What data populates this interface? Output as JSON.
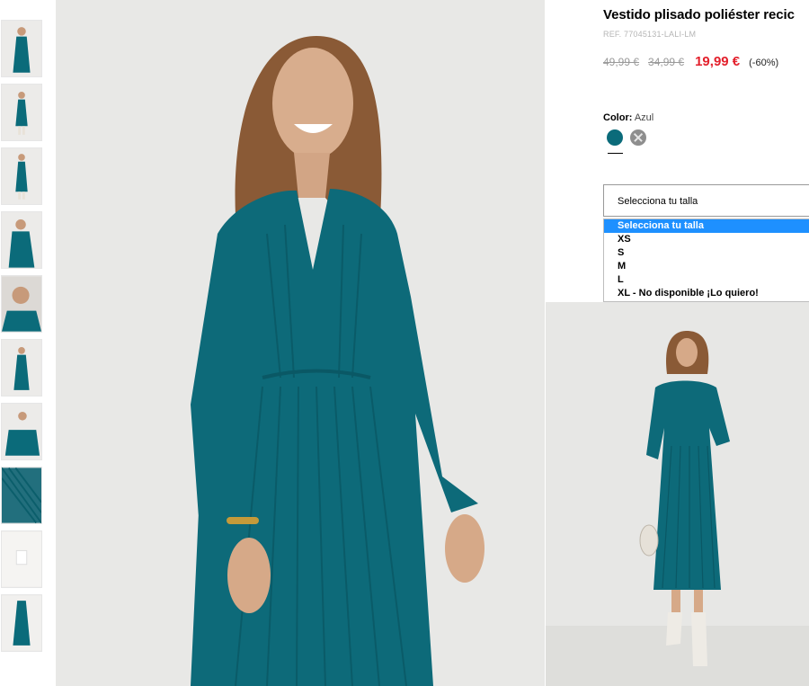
{
  "product": {
    "title": "Vestido plisado poliéster recic",
    "ref": "REF. 77045131-LALI-LM",
    "prices": {
      "original": "49,99 €",
      "previous": "34,99 €",
      "current": "19,99 €",
      "discount": "(-60%)"
    },
    "color": {
      "label": "Color:",
      "value": "Azul",
      "swatches": [
        {
          "name": "Azul",
          "hex": "#0b6b7a",
          "selected": true
        },
        {
          "name": "Gris",
          "hex": "#8e8e8e",
          "selected": false
        }
      ]
    },
    "size": {
      "placeholder": "Selecciona tu talla",
      "options": [
        "Selecciona tu talla",
        "XS",
        "S",
        "M",
        "L",
        "XL - No disponible ¡Lo quiero!"
      ],
      "highlighted": "Selecciona tu talla"
    }
  },
  "gallery": {
    "thumbnail_count": 10,
    "dress_color": "#0b6b7a"
  }
}
